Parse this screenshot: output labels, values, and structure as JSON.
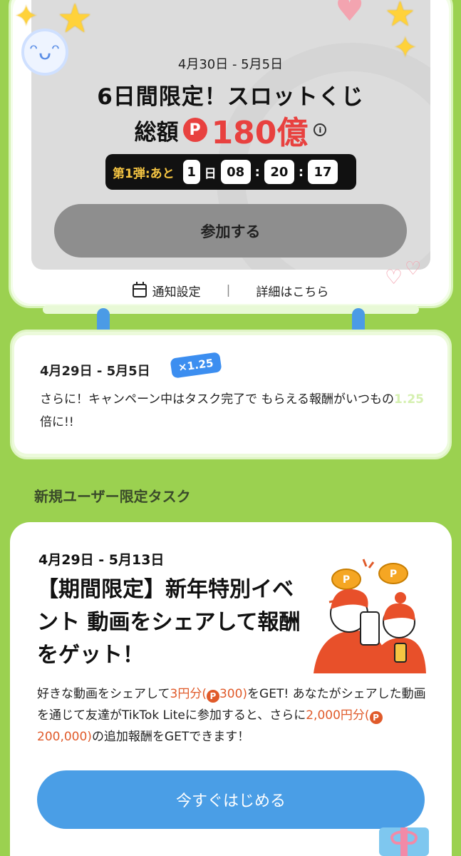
{
  "slot": {
    "date_range": "4月30日 - 5月5日",
    "title": "6日間限定！スロットくじ",
    "total_label": "総額",
    "point_symbol": "P",
    "total_amount": "180億",
    "info_symbol": "i",
    "countdown": {
      "prefix": "第1弾:あと",
      "days": "1",
      "days_unit": "日",
      "hours": "08",
      "minutes": "20",
      "seconds": "17",
      "separator": ":"
    },
    "join_button": "参加する",
    "notify_link": "通知設定",
    "link_separator": "|",
    "details_link": "詳細はこちら"
  },
  "bonus": {
    "date_range": "4月29日 - 5月5日",
    "multiplier_badge": "×1.25",
    "text_before": "さらに！キャンペーン中はタスク完了で もらえる報酬がいつもの",
    "text_highlight": "1.25",
    "text_after": "倍に!!"
  },
  "new_user_section": {
    "title": "新規ユーザー限定タスク"
  },
  "task": {
    "date_range": "4月29日 - 5月13日",
    "title": "【期間限定】新年特別イベント 動画をシェアして報酬をゲット！",
    "desc_1": "好きな動画をシェアして",
    "reward_1": "3円分(",
    "reward_1_points": "300)",
    "desc_2": "をGET! あなたがシェアした動画を通じて友達がTikTok Liteに参加すると、さらに",
    "reward_2": "2,000円分(",
    "reward_2_points": "200,000)",
    "desc_3": "の追加報酬をGETできます！",
    "point_symbol": "P",
    "start_button": "今すぐはじめる"
  },
  "colors": {
    "background": "#9bd150",
    "accent_red": "#e8413f",
    "accent_orange": "#e05a2a",
    "accent_blue": "#4a9ee6",
    "countdown_yellow": "#f5c542"
  },
  "icons": [
    "smiley-icon",
    "star-icon",
    "heart-icon",
    "info-icon",
    "calendar-icon",
    "point-coin-icon",
    "gift-icon"
  ]
}
